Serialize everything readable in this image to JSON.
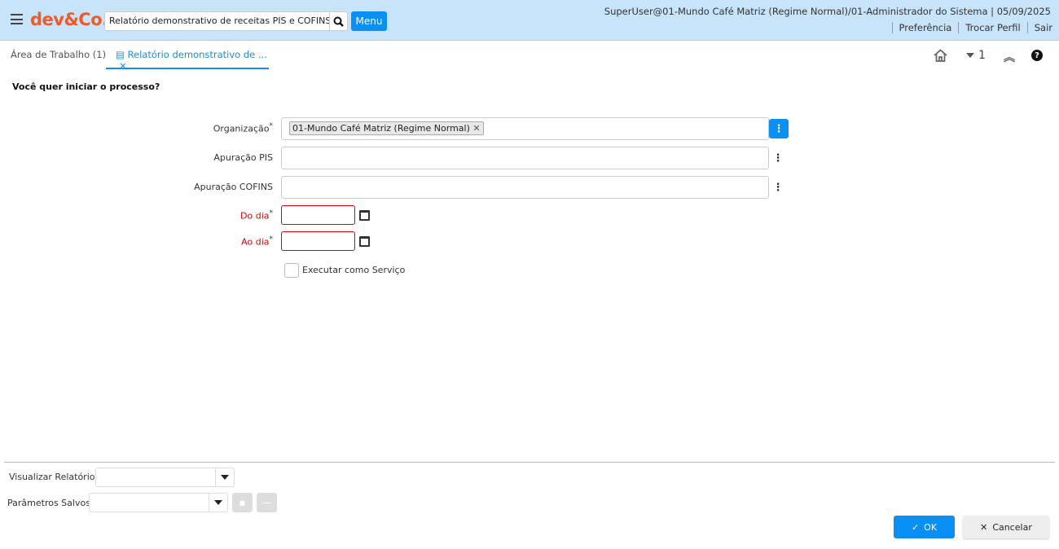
{
  "header": {
    "logo": "dev&Co.",
    "search_value": "Relatório demonstrativo de receitas PIS e COFINS",
    "menu_label": "Menu",
    "user_info": "SuperUser@01-Mundo Café Matriz (Regime Normal)/01-Administrador do Sistema | 05/09/2025",
    "links": [
      "Preferência",
      "Trocar Perfil",
      "Sair"
    ]
  },
  "tabs": [
    {
      "label": "Área de Trabalho (1)"
    },
    {
      "label": "Relatório demonstrativo de ..."
    }
  ],
  "toolbar": {
    "window_count": "1"
  },
  "form": {
    "question": "Você quer iniciar o processo?",
    "organizacao_label": "Organização",
    "organizacao_value": "01-Mundo Café Matriz (Regime Normal)",
    "apuracao_pis_label": "Apuração PIS",
    "apuracao_cofins_label": "Apuração COFINS",
    "do_dia_label": "Do dia",
    "ao_dia_label": "Ao dia",
    "required_mark": "*",
    "executar_label": "Executar como Serviço"
  },
  "footer": {
    "visualizar_label": "Visualizar Relatório",
    "parametros_label": "Parâmetros Salvos",
    "ok_label": "OK",
    "cancel_label": "Cancelar"
  }
}
